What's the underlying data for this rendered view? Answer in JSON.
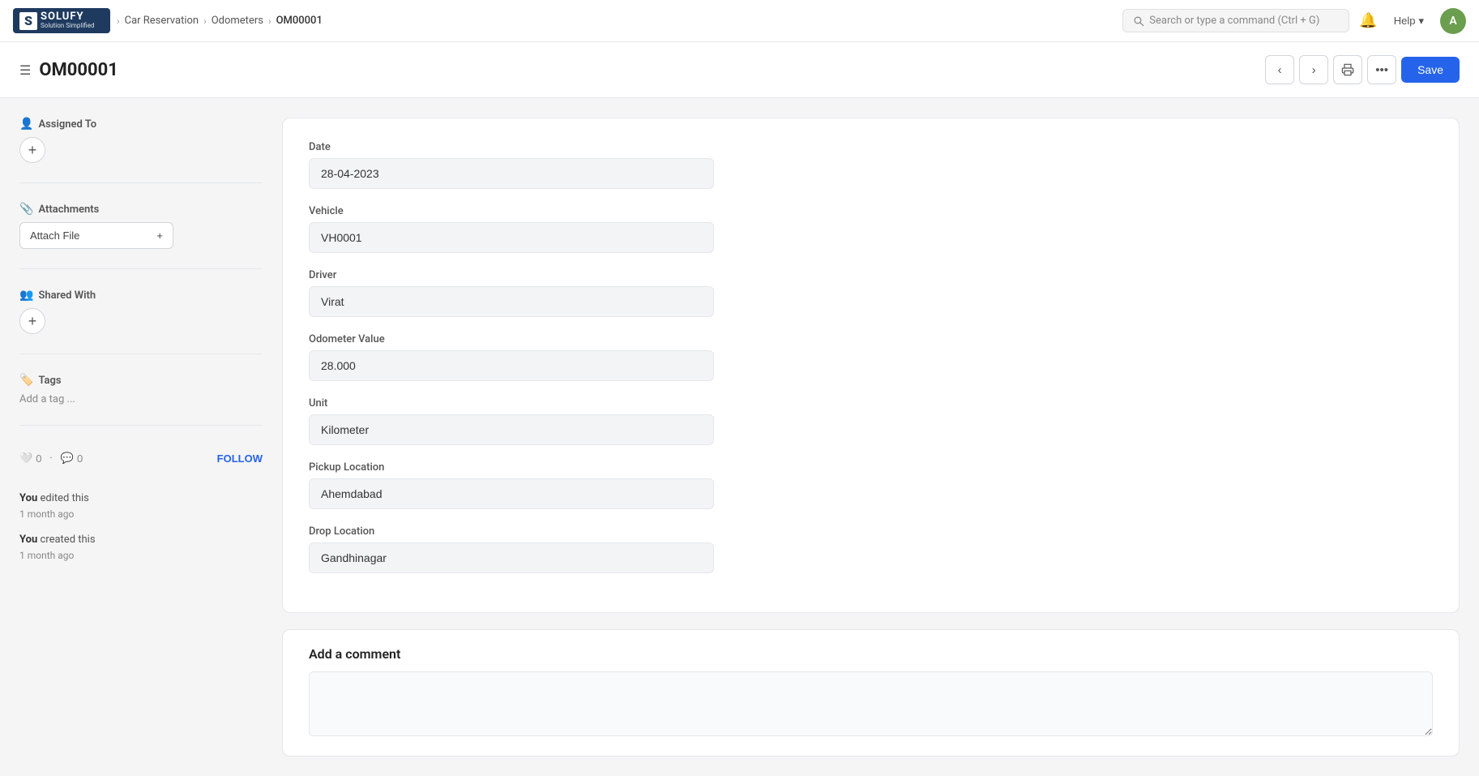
{
  "logo": {
    "s": "S",
    "name": "SOLUFY",
    "sub": "Solution Simplified"
  },
  "breadcrumb": {
    "items": [
      "Car Reservation",
      "Odometers",
      "OM00001"
    ]
  },
  "search": {
    "placeholder": "Search or type a command (Ctrl + G)"
  },
  "header": {
    "title": "OM00001",
    "help_label": "Help",
    "save_label": "Save",
    "avatar": "A"
  },
  "toolbar": {
    "prev_label": "‹",
    "next_label": "›",
    "print_label": "⎙",
    "more_label": "•••"
  },
  "sidebar": {
    "assigned_to_label": "Assigned To",
    "attachments_label": "Attachments",
    "attach_file_label": "Attach File",
    "shared_with_label": "Shared With",
    "tags_label": "Tags",
    "add_tag_placeholder": "Add a tag ...",
    "likes_count": "0",
    "comments_count": "0",
    "follow_label": "FOLLOW",
    "activity": [
      {
        "action_prefix": "You",
        "action": " edited this",
        "time": "1 month ago"
      },
      {
        "action_prefix": "You",
        "action": " created this",
        "time": "1 month ago"
      }
    ]
  },
  "form": {
    "date_label": "Date",
    "date_value": "28-04-2023",
    "vehicle_label": "Vehicle",
    "vehicle_value": "VH0001",
    "driver_label": "Driver",
    "driver_value": "Virat",
    "odometer_label": "Odometer Value",
    "odometer_value": "28.000",
    "unit_label": "Unit",
    "unit_value": "Kilometer",
    "pickup_label": "Pickup Location",
    "pickup_value": "Ahemdabad",
    "drop_label": "Drop Location",
    "drop_value": "Gandhinagar"
  },
  "comment_section": {
    "title": "Add a comment",
    "placeholder": ""
  }
}
